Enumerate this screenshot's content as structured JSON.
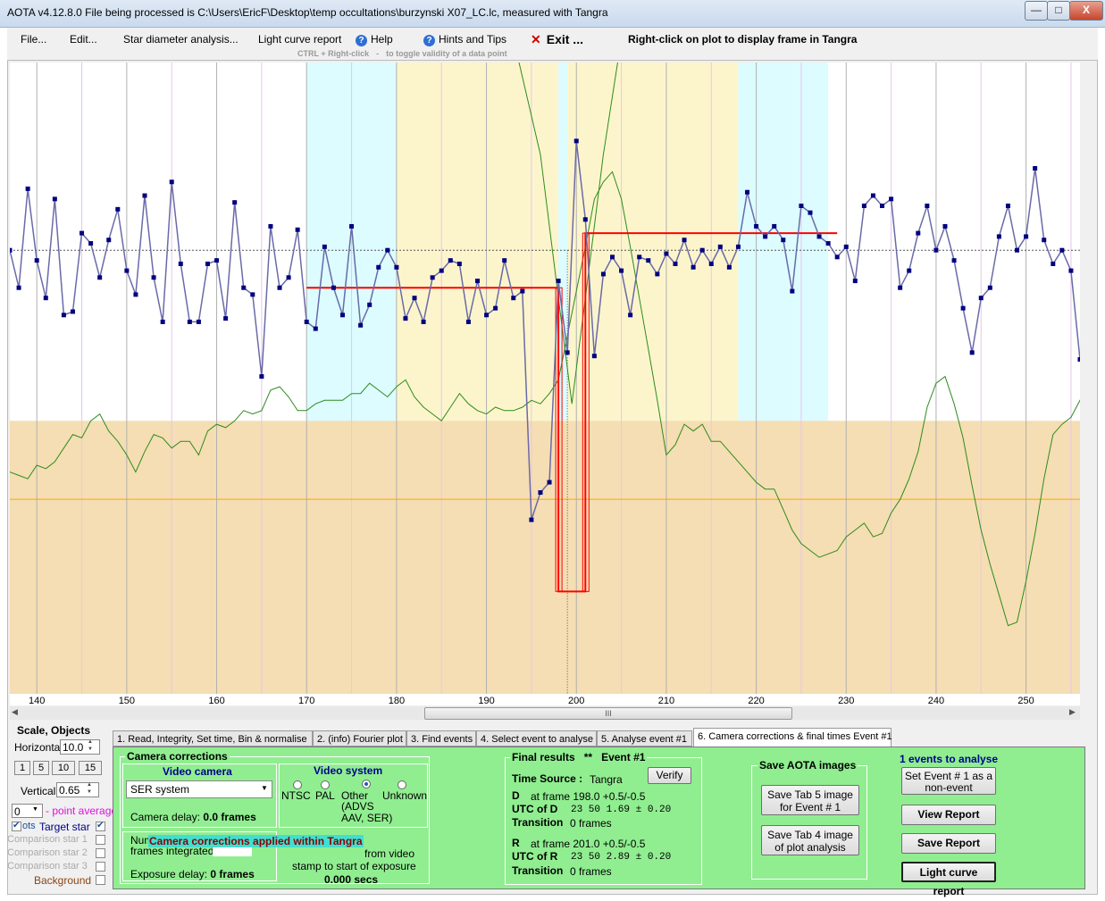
{
  "window": {
    "title": "AOTA v4.12.8.0    File being processed is C:\\Users\\EricF\\Desktop\\temp occultations\\burzynski X07_LC.lc, measured with Tangra",
    "min": "—",
    "max": "□",
    "close": "X"
  },
  "menu": {
    "file": "File...",
    "edit": "Edit...",
    "star_diameter": "Star diameter analysis...",
    "light_curve_report": "Light curve report",
    "help": "Help",
    "hints": "Hints and Tips",
    "exit": "Exit ...",
    "right_click_hint": "Right-click on plot to display frame in Tangra",
    "ctrl_hint_key": "CTRL + Right-click",
    "ctrl_hint_text": "to toggle validity of a data point",
    "help_glyph": "?",
    "exit_glyph": "✕"
  },
  "chart_data": {
    "type": "line",
    "title": "",
    "xlabel": "",
    "ylabel": "",
    "xlim": [
      137,
      256
    ],
    "ylim": [
      -0.3,
      1.55
    ],
    "xticks": [
      140,
      150,
      160,
      170,
      180,
      190,
      200,
      210,
      220,
      230,
      240,
      250
    ],
    "mean_level": 1.0,
    "bands": [
      {
        "from": 170,
        "to": 180,
        "color": "#dcfcff"
      },
      {
        "from": 180,
        "to": 198,
        "color": "#fcf5cc"
      },
      {
        "from": 198,
        "to": 199,
        "color": "#dcfcff"
      },
      {
        "from": 199,
        "to": 218,
        "color": "#fcf5cc"
      },
      {
        "from": 218,
        "to": 228,
        "color": "#dcfcff"
      }
    ],
    "target_star": {
      "x_start": 137,
      "values": [
        1.0,
        0.89,
        1.18,
        0.97,
        0.86,
        1.15,
        0.81,
        0.82,
        1.05,
        1.02,
        0.92,
        1.03,
        1.12,
        0.94,
        0.87,
        1.16,
        0.92,
        0.79,
        1.2,
        0.96,
        0.79,
        0.79,
        0.96,
        0.97,
        0.8,
        1.14,
        0.89,
        0.87,
        0.63,
        1.07,
        0.89,
        0.92,
        1.06,
        0.79,
        0.77,
        1.01,
        0.89,
        0.81,
        1.07,
        0.78,
        0.84,
        0.95,
        1.0,
        0.95,
        0.8,
        0.86,
        0.79,
        0.92,
        0.94,
        0.97,
        0.96,
        0.79,
        0.91,
        0.81,
        0.83,
        0.97,
        0.86,
        0.88,
        0.21,
        0.29,
        0.32,
        0.91,
        0.7,
        1.32,
        1.09,
        0.69,
        0.93,
        0.98,
        0.94,
        0.81,
        0.98,
        0.97,
        0.93,
        0.99,
        0.96,
        1.03,
        0.95,
        1.0,
        0.96,
        1.01,
        0.95,
        1.01,
        1.17,
        1.07,
        1.04,
        1.07,
        1.03,
        0.88,
        1.13,
        1.11,
        1.04,
        1.02,
        0.98,
        1.01,
        0.91,
        1.13,
        1.16,
        1.13,
        1.15,
        0.89,
        0.94,
        1.05,
        1.13,
        1.0,
        1.07,
        0.97,
        0.83,
        0.7,
        0.86,
        0.89,
        1.04,
        1.13,
        1.0,
        1.04,
        1.24,
        1.03,
        0.96,
        1.0,
        0.94,
        0.68,
        0.96,
        0.91
      ]
    },
    "comparison_star": {
      "x_start": 137,
      "values": [
        0.35,
        0.34,
        0.33,
        0.37,
        0.36,
        0.38,
        0.42,
        0.46,
        0.45,
        0.5,
        0.52,
        0.47,
        0.44,
        0.4,
        0.35,
        0.41,
        0.46,
        0.45,
        0.42,
        0.44,
        0.44,
        0.4,
        0.47,
        0.49,
        0.48,
        0.5,
        0.53,
        0.52,
        0.53,
        0.59,
        0.6,
        0.57,
        0.53,
        0.53,
        0.55,
        0.56,
        0.56,
        0.56,
        0.58,
        0.58,
        0.61,
        0.59,
        0.57,
        0.6,
        0.62,
        0.57,
        0.54,
        0.52,
        0.5,
        0.54,
        0.58,
        0.55,
        0.53,
        0.52,
        0.54,
        0.53,
        0.53,
        0.54,
        0.56,
        0.55,
        0.58,
        0.62,
        0.75,
        0.88,
        1.01,
        1.15,
        1.2,
        1.23,
        1.15,
        1.01,
        0.86,
        0.71,
        0.56,
        0.4,
        0.43,
        0.49,
        0.47,
        0.49,
        0.44,
        0.44,
        0.41,
        0.38,
        0.35,
        0.32,
        0.3,
        0.3,
        0.24,
        0.18,
        0.14,
        0.12,
        0.1,
        0.11,
        0.12,
        0.16,
        0.18,
        0.2,
        0.16,
        0.17,
        0.23,
        0.27,
        0.33,
        0.41,
        0.54,
        0.61,
        0.63,
        0.55,
        0.45,
        0.31,
        0.18,
        0.08,
        -0.01,
        -0.1,
        -0.09,
        0.03,
        0.17,
        0.33,
        0.46,
        0.49,
        0.51,
        0.56,
        0.5,
        0.45
      ]
    },
    "model": {
      "pre_level": 0.89,
      "event_level": 0.0,
      "post_level": 1.05,
      "x_left": 170,
      "x_D": 198,
      "x_R": 201,
      "x_right": 229
    },
    "green_curve": [
      {
        "x": 190,
        "y": 1.82
      },
      {
        "x": 193,
        "y": 1.62
      },
      {
        "x": 196,
        "y": 1.28
      },
      {
        "x": 198,
        "y": 0.86
      },
      {
        "x": 199.5,
        "y": 0.55
      },
      {
        "x": 201,
        "y": 0.86
      },
      {
        "x": 203,
        "y": 1.28
      },
      {
        "x": 205,
        "y": 1.62
      },
      {
        "x": 207.2,
        "y": 1.82
      }
    ]
  },
  "scrollbar": {
    "thumb": "III"
  },
  "left_panel": {
    "scale_objects": "Scale,  Objects",
    "horizontal_label": "Horizontal",
    "horizontal_value": "10.0",
    "quick_scales": [
      "1",
      "5",
      "10",
      "15"
    ],
    "vertical_label": "Vertical",
    "vertical_value": "0.65",
    "point_avg_value": "0",
    "point_avg_label": "- point average",
    "plots_label": "ots",
    "objects": [
      {
        "name": "Target star",
        "checked": true
      },
      {
        "name": "Comparison star 1",
        "checked": false
      },
      {
        "name": "Comparison star 2",
        "checked": false
      },
      {
        "name": "Comparison star 3",
        "checked": false
      },
      {
        "name": "Background",
        "checked": false
      }
    ],
    "check_glyph": "✔",
    "spin_up": "▲",
    "spin_down": "▼",
    "dropdown_glyph": "▼"
  },
  "tabs": [
    "1. Read, Integrity, Set time, Bin & normalise",
    "2. (info)  Fourier plot",
    "3. Find events",
    "4. Select event to analyse",
    "5. Analyse event #1",
    "6. Camera corrections & final times Event #1"
  ],
  "camera": {
    "group_title": "Camera corrections",
    "video_camera_title": "Video camera",
    "camera_value": "SER system",
    "camera_delay_label": "Camera delay:",
    "camera_delay_value": "0.0 frames",
    "video_system_title": "Video system",
    "systems": [
      "NTSC",
      "PAL",
      "Other",
      "Unknown"
    ],
    "other_note": "(ADVS AAV, SER)",
    "num_label_start": "Num",
    "frames_integrated": "frames integrated",
    "overlay_banner": "Camera corrections applied within Tangra",
    "from_video": "from video",
    "stamp_to_start": "stamp to start of exposure",
    "stamp_value": "0.000 secs",
    "exposure_delay_label": "Exposure delay:",
    "exposure_delay_value": "0 frames"
  },
  "final": {
    "title": "Final results",
    "stars": "**",
    "event": "Event #1",
    "time_source_label": "Time Source :",
    "time_source_value": "Tangra",
    "verify": "Verify",
    "D": {
      "label": "D",
      "frame_text": "at frame 198.0  +0.5/-0.5",
      "utc_label": "UTC of D",
      "utc_value": "23  50   1.69  ± 0.20",
      "transition_label": "Transition",
      "transition_value": "0 frames"
    },
    "R": {
      "label": "R",
      "frame_text": "at frame 201.0  +0.5/-0.5",
      "utc_label": "UTC of R",
      "utc_value": "23  50   2.89  ± 0.20",
      "transition_label": "Transition",
      "transition_value": "0 frames"
    }
  },
  "save": {
    "title": "Save AOTA images",
    "tab5": "Save Tab 5 image for Event # 1",
    "tab4": "Save Tab 4 image of plot analysis"
  },
  "right_actions": {
    "events_label": "1  events to analyse",
    "set_nonevent": "Set Event # 1 as a non-event",
    "view_report": "View Report",
    "save_report": "Save Report",
    "light_curve_report": "Light curve report"
  },
  "colors": {
    "panel_green": "#90ee90",
    "tan": "#f5deb3",
    "cyan_band": "#dcfcff",
    "yellow_band": "#fcf5cc",
    "series": "#6a6aa8",
    "point": "#000080",
    "model": "#ff0000",
    "green": "#2e8b1e",
    "baseline": "#ffa500"
  }
}
